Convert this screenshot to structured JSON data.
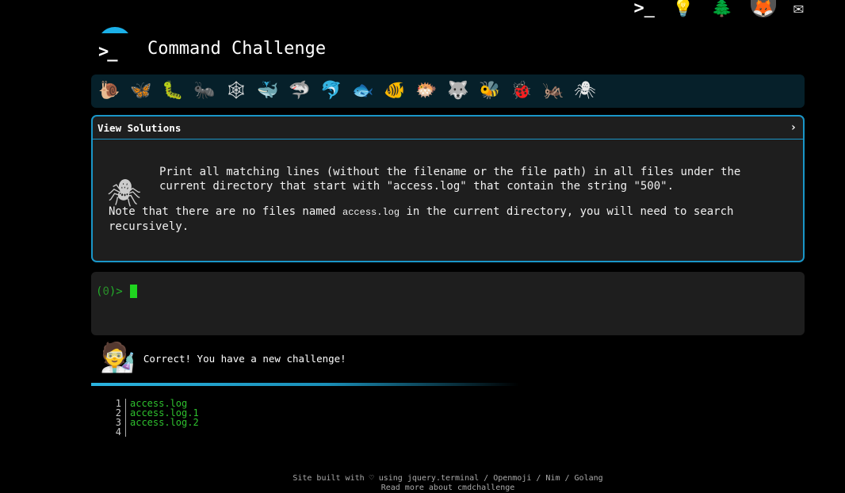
{
  "header": {
    "title": "Command Challenge"
  },
  "top_icons": {
    "terminal": "terminal-icon",
    "lightbulb": "lightbulb-icon",
    "tree": "tree-icon",
    "gitlab": "gitlab-icon",
    "mail": "mail-icon"
  },
  "levels": [
    {
      "icon": "🐌",
      "name": "snail-icon"
    },
    {
      "icon": "🦋",
      "name": "butterfly-icon"
    },
    {
      "icon": "🐛",
      "name": "caterpillar-icon"
    },
    {
      "icon": "🐜",
      "name": "ant-icon"
    },
    {
      "icon": "🕸",
      "name": "spider-web-icon"
    },
    {
      "icon": "🐳",
      "name": "whale-icon"
    },
    {
      "icon": "🦈",
      "name": "shark-icon"
    },
    {
      "icon": "🐬",
      "name": "dolphin-icon"
    },
    {
      "icon": "🐟",
      "name": "fish-icon"
    },
    {
      "icon": "🐠",
      "name": "tropical-fish-icon"
    },
    {
      "icon": "🐡",
      "name": "blowfish-icon"
    },
    {
      "icon": "🐺",
      "name": "wolf-icon"
    },
    {
      "icon": "🐝",
      "name": "bee-icon"
    },
    {
      "icon": "🐞",
      "name": "ladybug-icon"
    },
    {
      "icon": "🦗",
      "name": "cricket-icon"
    },
    {
      "icon": "🕷",
      "name": "spider-icon"
    }
  ],
  "challenge": {
    "solutions_label": "View Solutions",
    "chevron": "›",
    "task": "Print all matching lines (without the filename or the file path) in all files under the\ncurrent directory that start with \"access.log\" that contain the string \"500\".",
    "note_prefix": "Note that there are no files named ",
    "note_code": "access.log",
    "note_suffix": " in the current directory, you will need to search recursively."
  },
  "terminal": {
    "prompt_open": "(",
    "prompt_num": "0",
    "prompt_close": ")>"
  },
  "feedback": {
    "message": "Correct! You have a new challenge!"
  },
  "listing": {
    "line_numbers": [
      "1",
      "2",
      "3",
      "4"
    ],
    "files": [
      "access.log",
      "access.log.1",
      "access.log.2",
      ""
    ]
  },
  "footer": {
    "line1": "Site built with ♡ using jquery.terminal / Openmoji / Nim / Golang",
    "line2": "Read more about cmdchallenge"
  },
  "colors": {
    "accent": "#1a96c8",
    "prompt_green": "#23b02a",
    "cursor_green": "#1fd41f"
  }
}
